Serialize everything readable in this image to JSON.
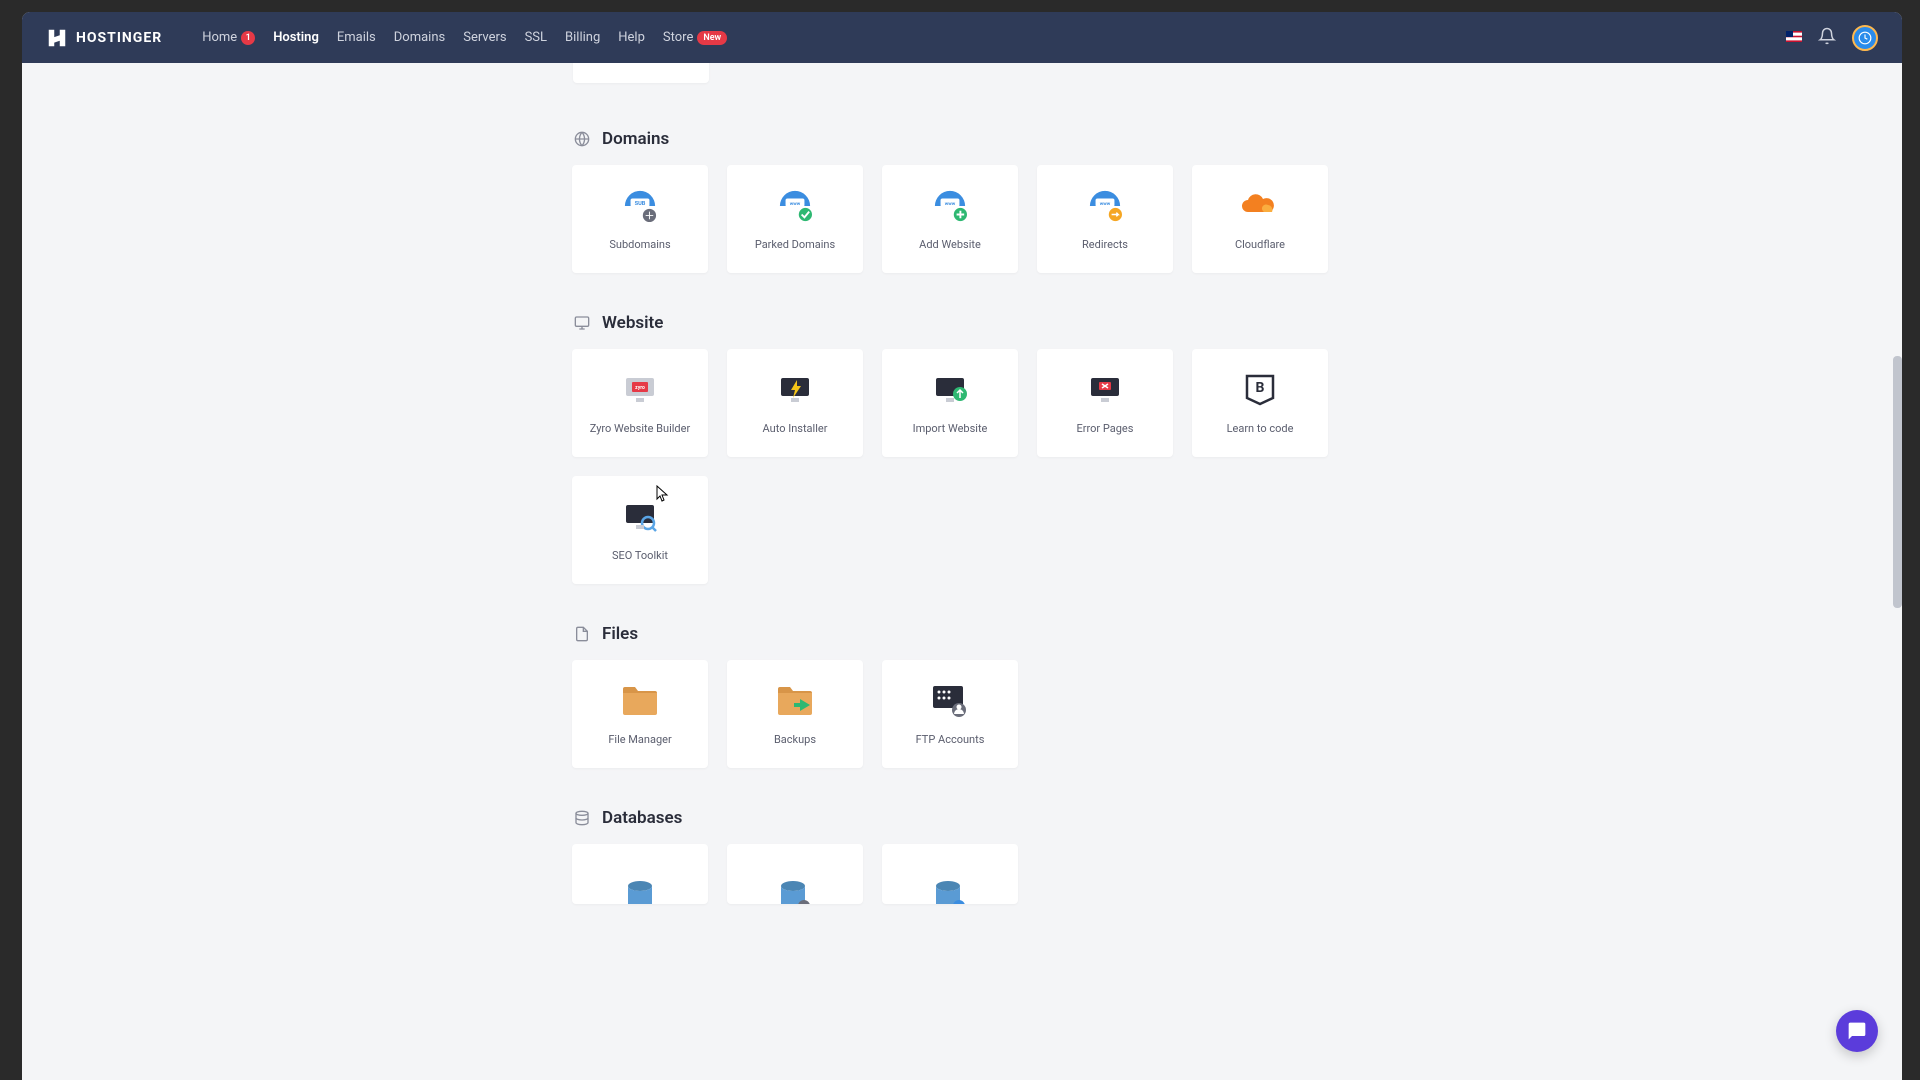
{
  "brand": "HOSTINGER",
  "nav": {
    "home": "Home",
    "home_badge": "1",
    "hosting": "Hosting",
    "emails": "Emails",
    "domains": "Domains",
    "servers": "Servers",
    "ssl": "SSL",
    "billing": "Billing",
    "help": "Help",
    "store": "Store",
    "store_badge": "New"
  },
  "sections": {
    "domains": {
      "title": "Domains",
      "tiles": {
        "subdomains": "Subdomains",
        "parked": "Parked Domains",
        "add_website": "Add Website",
        "redirects": "Redirects",
        "cloudflare": "Cloudflare"
      }
    },
    "website": {
      "title": "Website",
      "tiles": {
        "zyro": "Zyro Website Builder",
        "auto_installer": "Auto Installer",
        "import_website": "Import Website",
        "error_pages": "Error Pages",
        "learn_to_code": "Learn to code",
        "seo_toolkit": "SEO Toolkit"
      }
    },
    "files": {
      "title": "Files",
      "tiles": {
        "file_manager": "File Manager",
        "backups": "Backups",
        "ftp_accounts": "FTP Accounts"
      }
    },
    "databases": {
      "title": "Databases"
    }
  }
}
